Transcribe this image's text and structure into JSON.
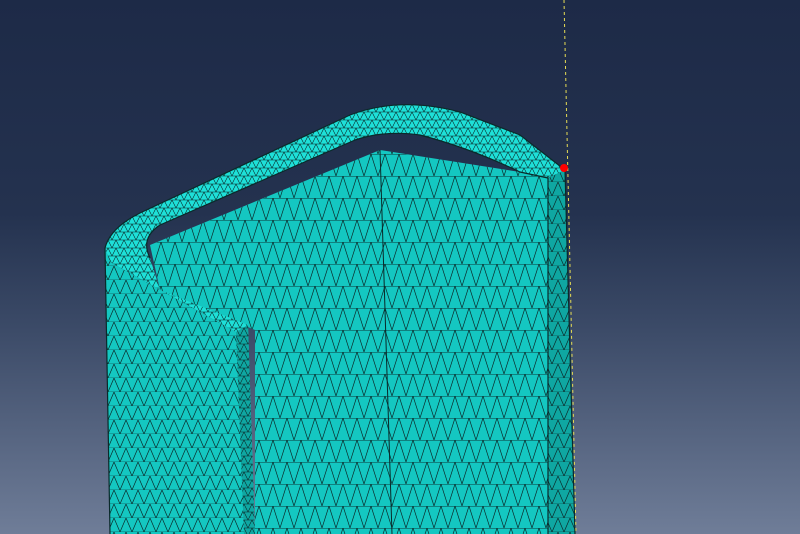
{
  "viewport": {
    "background_top": "#1d2a47",
    "background_bottom": "#6f7d98"
  },
  "mesh": {
    "fill_color": "#14c7c1",
    "fill_light": "#1ee0d8",
    "fill_dark": "#0fa7a2",
    "edge_color": "#0a2a2a"
  },
  "selection": {
    "marker_color": "#ff0000",
    "guide_line_color": "#e6dc54"
  }
}
